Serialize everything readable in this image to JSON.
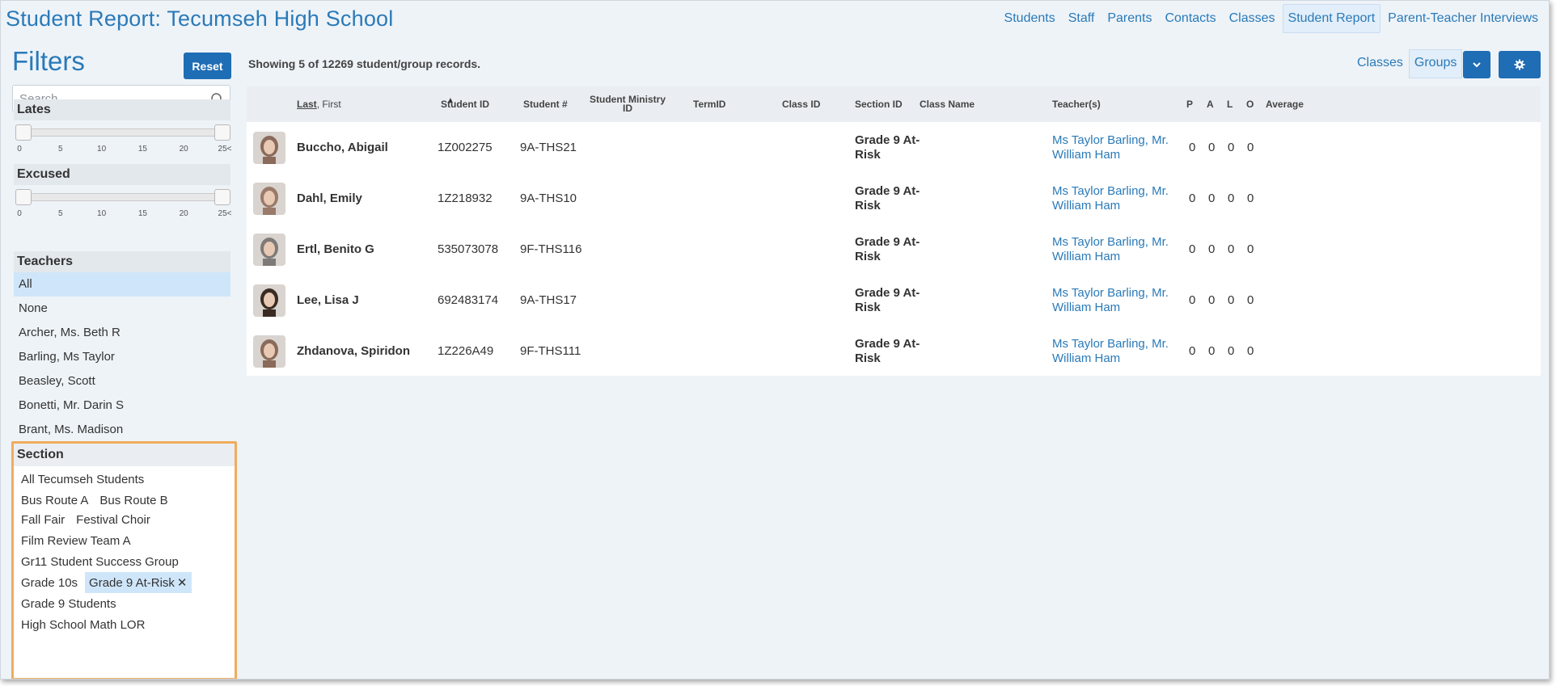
{
  "header": {
    "title": "Student Report: Tecumseh High School",
    "nav": [
      {
        "label": "Students",
        "active": false
      },
      {
        "label": "Staff",
        "active": false
      },
      {
        "label": "Parents",
        "active": false
      },
      {
        "label": "Contacts",
        "active": false
      },
      {
        "label": "Classes",
        "active": false
      },
      {
        "label": "Student Report",
        "active": true
      },
      {
        "label": "Parent-Teacher Interviews",
        "active": false
      }
    ]
  },
  "filters": {
    "title": "Filters",
    "reset_label": "Reset",
    "search_placeholder": "Search",
    "lates": {
      "label": "Lates",
      "ticks": [
        "0",
        "5",
        "10",
        "15",
        "20",
        "25<"
      ],
      "range": [
        0,
        25
      ]
    },
    "excused": {
      "label": "Excused",
      "ticks": [
        "0",
        "5",
        "10",
        "15",
        "20",
        "25<"
      ],
      "range": [
        0,
        25
      ]
    },
    "teachers": {
      "label": "Teachers",
      "items": [
        {
          "label": "All",
          "selected": true
        },
        {
          "label": "None",
          "selected": false
        },
        {
          "label": "Archer, Ms. Beth R",
          "selected": false
        },
        {
          "label": "Barling, Ms Taylor",
          "selected": false
        },
        {
          "label": "Beasley, Scott",
          "selected": false
        },
        {
          "label": "Bonetti, Mr. Darin S",
          "selected": false
        },
        {
          "label": "Brant, Ms. Madison",
          "selected": false
        }
      ]
    },
    "section": {
      "label": "Section",
      "rows": [
        [
          {
            "label": "All Tecumseh Students",
            "selected": false
          }
        ],
        [
          {
            "label": "Bus Route A",
            "selected": false
          },
          {
            "label": "Bus Route B",
            "selected": false
          }
        ],
        [
          {
            "label": "Fall Fair",
            "selected": false
          },
          {
            "label": "Festival Choir",
            "selected": false
          }
        ],
        [
          {
            "label": "Film Review Team A",
            "selected": false
          }
        ],
        [
          {
            "label": "Gr11 Student Success Group",
            "selected": false
          }
        ],
        [
          {
            "label": "Grade 10s",
            "selected": false
          },
          {
            "label": "Grade 9 At-Risk",
            "selected": true,
            "remove": "✕"
          }
        ],
        [
          {
            "label": "Grade 9 Students",
            "selected": false
          }
        ],
        [
          {
            "label": "High School Math LOR",
            "selected": false
          }
        ]
      ]
    }
  },
  "main": {
    "records_text": "Showing 5 of 12269 student/group records.",
    "view_toggle": [
      {
        "label": "Classes",
        "active": false
      },
      {
        "label": "Groups",
        "active": true
      }
    ],
    "icons": {
      "dropdown": "chevron-down-icon",
      "settings": "gear-icon",
      "sort": "sort-up-icon"
    },
    "columns": {
      "name_last": "Last",
      "name_first": ", First",
      "student_id": "Student ID",
      "student_no": "Student #",
      "ministry_id": "Student Ministry ID",
      "term_id": "TermID",
      "class_id": "Class ID",
      "section_id": "Section ID",
      "class_name": "Class Name",
      "teachers": "Teacher(s)",
      "p": "P",
      "a": "A",
      "l": "L",
      "o": "O",
      "average": "Average"
    },
    "rows": [
      {
        "name": "Buccho, Abigail",
        "student_id": "1Z002275",
        "student_no": "9A-THS21",
        "ministry_id": "",
        "term_id": "",
        "class_id": "",
        "section_id": "Grade 9 At-Risk",
        "class_name": "",
        "teachers": "Ms Taylor Barling, Mr. William Ham",
        "p": "0",
        "a": "0",
        "l": "0",
        "o": "0",
        "average": "",
        "avatar_color": "#8a6a5a"
      },
      {
        "name": "Dahl, Emily",
        "student_id": "1Z218932",
        "student_no": "9A-THS10",
        "ministry_id": "",
        "term_id": "",
        "class_id": "",
        "section_id": "Grade 9 At-Risk",
        "class_name": "",
        "teachers": "Ms Taylor Barling, Mr. William Ham",
        "p": "0",
        "a": "0",
        "l": "0",
        "o": "0",
        "average": "",
        "avatar_color": "#9a7a6a"
      },
      {
        "name": "Ertl, Benito G",
        "student_id": "535073078",
        "student_no": "9F-THS116",
        "ministry_id": "",
        "term_id": "",
        "class_id": "",
        "section_id": "Grade 9 At-Risk",
        "class_name": "",
        "teachers": "Ms Taylor Barling, Mr. William Ham",
        "p": "0",
        "a": "0",
        "l": "0",
        "o": "0",
        "average": "",
        "avatar_color": "#7d7a78"
      },
      {
        "name": "Lee, Lisa J",
        "student_id": "692483174",
        "student_no": "9A-THS17",
        "ministry_id": "",
        "term_id": "",
        "class_id": "",
        "section_id": "Grade 9 At-Risk",
        "class_name": "",
        "teachers": "Ms Taylor Barling, Mr. William Ham",
        "p": "0",
        "a": "0",
        "l": "0",
        "o": "0",
        "average": "",
        "avatar_color": "#3a2a22"
      },
      {
        "name": "Zhdanova, Spiridon",
        "student_id": "1Z226A49",
        "student_no": "9F-THS111",
        "ministry_id": "",
        "term_id": "",
        "class_id": "",
        "section_id": "Grade 9 At-Risk",
        "class_name": "",
        "teachers": "Ms Taylor Barling, Mr. William Ham",
        "p": "0",
        "a": "0",
        "l": "0",
        "o": "0",
        "average": "",
        "avatar_color": "#8a6a5a"
      }
    ]
  },
  "colors": {
    "accent": "#2a7ab8",
    "button": "#1f6db5",
    "selected_bg": "#cfe6fa",
    "highlight_border": "#f0ac5c"
  }
}
